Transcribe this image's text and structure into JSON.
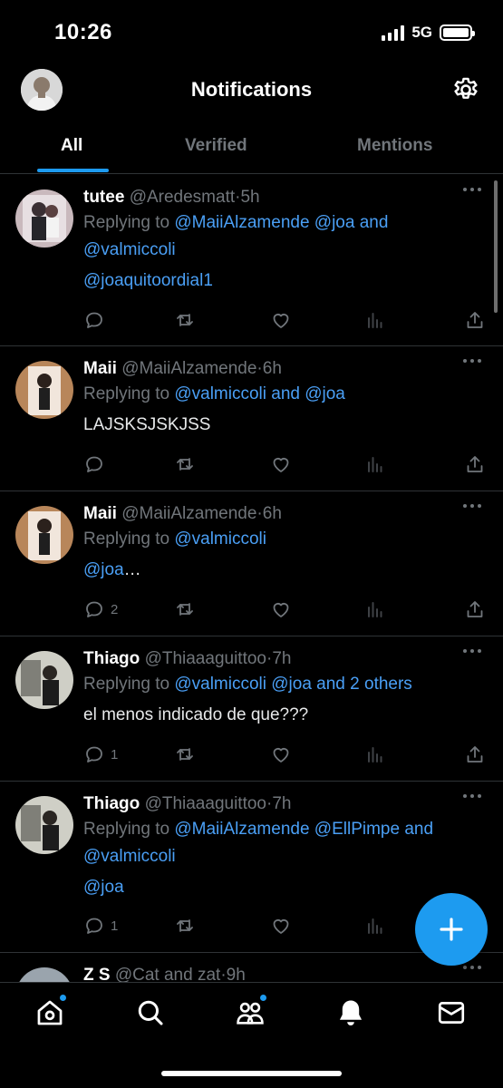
{
  "status": {
    "time": "10:26",
    "network": "5G"
  },
  "header": {
    "title": "Notifications"
  },
  "tabs": [
    {
      "label": "All",
      "active": true
    },
    {
      "label": "Verified",
      "active": false
    },
    {
      "label": "Mentions",
      "active": false
    }
  ],
  "tweets": [
    {
      "name": "tutee",
      "handle": "@Aredesmatt",
      "time": "5h",
      "reply_prefix": "Replying to ",
      "reply_line1_links": "@MaiiAlzamende @joa",
      "reply_line1_and": " and",
      "reply_line2": "@valmiccoli",
      "text": "@joaquitoordial1",
      "text_is_link": true,
      "reply_count": ""
    },
    {
      "name": "Maii",
      "handle": "@MaiiAlzamende",
      "time": "6h",
      "reply_prefix": "Replying to ",
      "reply_line1_links": "@valmiccoli and @joa",
      "reply_line1_and": "",
      "reply_line2": "",
      "text": "LAJSKSJSKJSS",
      "text_is_link": false,
      "reply_count": ""
    },
    {
      "name": "Maii",
      "handle": "@MaiiAlzamende",
      "time": "6h",
      "reply_prefix": "Replying to ",
      "reply_line1_links": "@valmiccoli",
      "reply_line1_and": "",
      "reply_line2": "",
      "text_link": "@joa",
      "text_suffix": "…",
      "reply_count": "2"
    },
    {
      "name": "Thiago",
      "handle": "@Thiaaaguittoo",
      "time": "7h",
      "reply_prefix": "Replying to ",
      "reply_line1_links": "@valmiccoli @joa and 2 others",
      "reply_line1_and": "",
      "reply_line2": "",
      "text": "el menos indicado de que???",
      "text_is_link": false,
      "reply_count": "1"
    },
    {
      "name": "Thiago",
      "handle": "@Thiaaaguittoo",
      "time": "7h",
      "reply_prefix": "Replying to ",
      "reply_line1_links": "@MaiiAlzamende @EllPimpe and",
      "reply_line1_and": "",
      "reply_line2": "@valmiccoli",
      "text": "@joa",
      "text_is_link": true,
      "reply_count": "1"
    },
    {
      "name": "Z S",
      "handle": "@Cat and zat",
      "time": "9h"
    }
  ],
  "colors": {
    "accent": "#1d9bf0",
    "muted": "#71767b",
    "background": "#000000"
  },
  "icons": {
    "header": [
      "avatar",
      "gear-icon"
    ],
    "actions": [
      "reply-icon",
      "retweet-icon",
      "like-icon",
      "views-icon",
      "share-icon"
    ],
    "nav": [
      "home-icon",
      "search-icon",
      "communities-icon",
      "bell-icon",
      "mail-icon"
    ],
    "fab": "plus-icon"
  }
}
